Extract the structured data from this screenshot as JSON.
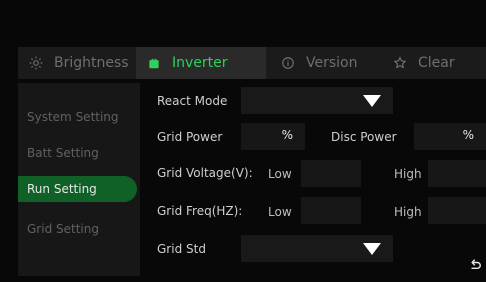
{
  "tabs": [
    {
      "label": "Brightness",
      "icon": "sun-icon"
    },
    {
      "label": "Inverter",
      "icon": "battery-icon",
      "active": true
    },
    {
      "label": "Version",
      "icon": "info-icon"
    },
    {
      "label": "Clear",
      "icon": "star-icon"
    }
  ],
  "sidebar": {
    "items": [
      {
        "label": "System Setting"
      },
      {
        "label": "Batt Setting"
      },
      {
        "label": "Run Setting",
        "active": true
      },
      {
        "label": "Grid Setting"
      }
    ]
  },
  "form": {
    "react_mode_label": "React Mode",
    "react_mode_value": "",
    "grid_power_label": "Grid Power",
    "grid_power_value": "",
    "grid_power_unit": "%",
    "disc_power_label": "Disc Power",
    "disc_power_value": "",
    "disc_power_unit": "%",
    "grid_voltage_label": "Grid Voltage(V):",
    "grid_freq_label": "Grid Freq(HZ):",
    "low_label": "Low",
    "high_label": "High",
    "grid_std_label": "Grid Std",
    "grid_std_value": ""
  },
  "colors": {
    "accent_green": "#2ed15a",
    "active_bg": "#0f6127"
  }
}
